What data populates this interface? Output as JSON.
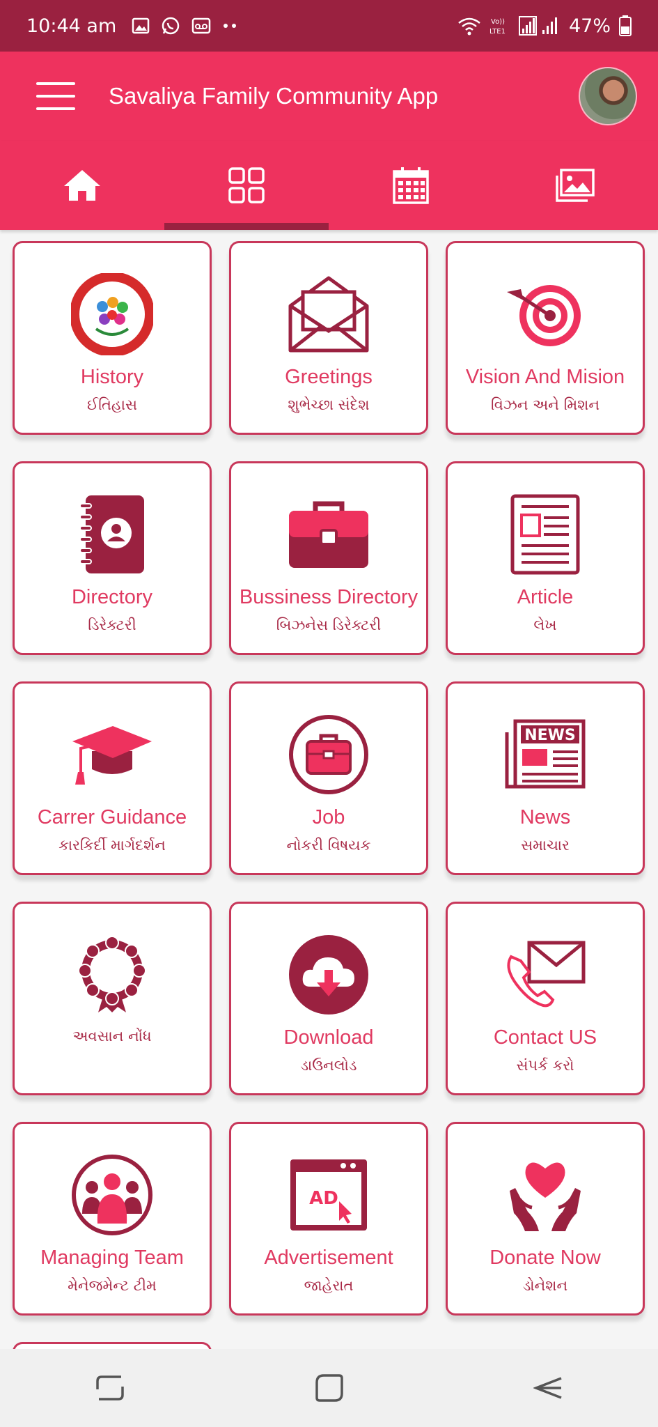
{
  "status": {
    "time": "10:44 am",
    "battery": "47%",
    "icons": [
      "image-icon",
      "whatsapp-icon",
      "voicemail-icon",
      "more-dots-icon",
      "wifi-icon",
      "volte-icon",
      "signal-icon",
      "battery-icon"
    ]
  },
  "appbar": {
    "title": "Savaliya Family Community App"
  },
  "tabs": [
    {
      "name": "home",
      "icon": "home-icon"
    },
    {
      "name": "grid",
      "icon": "grid-icon",
      "selected": true
    },
    {
      "name": "calendar",
      "icon": "calendar-icon"
    },
    {
      "name": "gallery",
      "icon": "gallery-icon"
    }
  ],
  "colors": {
    "status_bar": "#9a2140",
    "primary": "#ee325e",
    "dark": "#9a2140",
    "text_en": "#e03a61",
    "text_gu": "#a82946"
  },
  "cards": [
    {
      "en": "History",
      "gu": "ઈતિહાસ",
      "icon": "history-logo-icon"
    },
    {
      "en": "Greetings",
      "gu": "શુભેચ્છા સંદેશ",
      "icon": "envelope-open-icon"
    },
    {
      "en": "Vision And Mision",
      "gu": "વિઝન અને મિશન",
      "icon": "target-icon"
    },
    {
      "en": "Directory",
      "gu": "ડિરેક્ટરી",
      "icon": "address-book-icon"
    },
    {
      "en": "Bussiness Directory",
      "gu": "બિઝનેસ ડિરેક્ટરી",
      "icon": "briefcase-icon"
    },
    {
      "en": "Article",
      "gu": "લેખ",
      "icon": "article-icon"
    },
    {
      "en": "Carrer Guidance",
      "gu": "કારકિર્દી માર્ગદર્શન",
      "icon": "graduation-cap-icon"
    },
    {
      "en": "Job",
      "gu": "નોકરી વિષયક",
      "icon": "job-briefcase-icon"
    },
    {
      "en": "News",
      "gu": "સમાચાર",
      "icon": "newspaper-icon",
      "icon_text": "NEWS"
    },
    {
      "en": "",
      "gu": "અવસાન નોંધ",
      "icon": "wreath-icon"
    },
    {
      "en": "Download",
      "gu": "ડાઉનલોડ",
      "icon": "cloud-download-icon"
    },
    {
      "en": "Contact US",
      "gu": "સંપર્ક કરો",
      "icon": "contact-phone-mail-icon"
    },
    {
      "en": "Managing Team",
      "gu": "મેનેજમેન્ટ ટીમ",
      "icon": "team-icon"
    },
    {
      "en": "Advertisement",
      "gu": "જાહેરાત",
      "icon": "advertisement-icon",
      "icon_text": "AD"
    },
    {
      "en": "Donate Now",
      "gu": "ડોનેશન",
      "icon": "donate-heart-hands-icon"
    }
  ],
  "navbar": {
    "icons": [
      "recents-icon",
      "home-square-icon",
      "back-icon"
    ]
  }
}
